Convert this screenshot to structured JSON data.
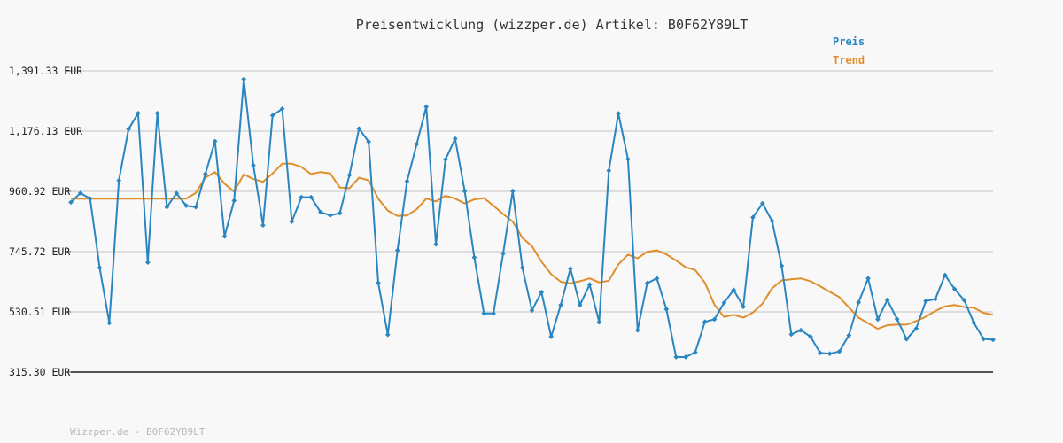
{
  "chart_data": {
    "type": "line",
    "title": "Preisentwicklung (wizzper.de) Artikel: B0F62Y89LT",
    "xlabel": "",
    "ylabel": "",
    "ylim": [
      315.3,
      1391.33
    ],
    "y_ticks": [
      "1,391.33 EUR",
      "1,176.13 EUR",
      "960.92 EUR",
      "745.72 EUR",
      "530.51 EUR",
      "315.30 EUR"
    ],
    "y_tick_values": [
      1391.33,
      1176.13,
      960.92,
      745.72,
      530.51,
      315.3
    ],
    "grid": true,
    "legend_position": "top-right",
    "series": [
      {
        "name": "Preis",
        "color": "#2a86c0",
        "markers": true,
        "values": [
          922,
          955,
          935,
          688,
          491,
          1000,
          1183,
          1240,
          707,
          1240,
          905,
          954,
          910,
          905,
          1023,
          1140,
          800,
          928,
          1362,
          1054,
          840,
          1232,
          1256,
          853,
          940,
          940,
          887,
          875,
          883,
          1019,
          1185,
          1138,
          634,
          449,
          750,
          997,
          1130,
          1263,
          772,
          1075,
          1149,
          962,
          725,
          525,
          525,
          739,
          962,
          688,
          536,
          601,
          442,
          555,
          685,
          555,
          628,
          494,
          1035,
          1239,
          1076,
          465,
          633,
          650,
          540,
          369,
          369,
          386,
          495,
          504,
          563,
          609,
          549,
          868,
          918,
          855,
          695,
          450,
          465,
          442,
          384,
          381,
          389,
          447,
          564,
          650,
          504,
          573,
          505,
          433,
          471,
          569,
          576,
          662,
          612,
          572,
          492,
          434,
          431
        ]
      },
      {
        "name": "Trend",
        "color": "#e08e2c",
        "markers": false,
        "values": [
          935,
          935,
          935,
          935,
          935,
          935,
          935,
          935,
          935,
          935,
          935,
          935,
          935,
          955,
          1010,
          1030,
          988,
          960,
          1022,
          1005,
          995,
          1025,
          1060,
          1060,
          1048,
          1023,
          1030,
          1025,
          975,
          972,
          1010,
          1000,
          935,
          892,
          873,
          875,
          897,
          935,
          925,
          945,
          935,
          918,
          932,
          937,
          910,
          880,
          853,
          795,
          765,
          710,
          665,
          638,
          632,
          640,
          650,
          636,
          642,
          700,
          735,
          722,
          745,
          750,
          736,
          714,
          690,
          680,
          635,
          556,
          512,
          520,
          510,
          528,
          560,
          615,
          643,
          647,
          650,
          640,
          622,
          602,
          583,
          546,
          510,
          490,
          470,
          483,
          485,
          485,
          498,
          513,
          534,
          550,
          555,
          548,
          545,
          527,
          520
        ]
      }
    ]
  },
  "watermark": "Wizzper.de - B0F62Y89LT"
}
